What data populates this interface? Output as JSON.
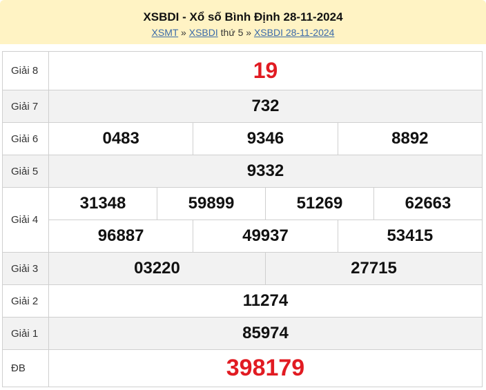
{
  "header": {
    "title": "XSBDI - Xổ số Bình Định 28-11-2024",
    "crumb_1": "XSMT",
    "sep_1": " » ",
    "crumb_2": "XSBDI",
    "crumb_2_suffix": " thứ 5",
    "sep_2": " » ",
    "crumb_3": "XSBDI 28-11-2024"
  },
  "prizes": {
    "g8": {
      "label": "Giải 8",
      "values": [
        "19"
      ]
    },
    "g7": {
      "label": "Giải 7",
      "values": [
        "732"
      ]
    },
    "g6": {
      "label": "Giải 6",
      "values": [
        "0483",
        "9346",
        "8892"
      ]
    },
    "g5": {
      "label": "Giải 5",
      "values": [
        "9332"
      ]
    },
    "g4": {
      "label": "Giải 4",
      "values": [
        "31348",
        "59899",
        "51269",
        "62663",
        "96887",
        "49937",
        "53415"
      ]
    },
    "g3": {
      "label": "Giải 3",
      "values": [
        "03220",
        "27715"
      ]
    },
    "g2": {
      "label": "Giải 2",
      "values": [
        "11274"
      ]
    },
    "g1": {
      "label": "Giải 1",
      "values": [
        "85974"
      ]
    },
    "db": {
      "label": "ĐB",
      "values": [
        "398179"
      ]
    }
  },
  "colors": {
    "header_bg": "#fff3c4",
    "highlight": "#e11b22",
    "link": "#3a6aa8",
    "row_alt": "#f2f2f2"
  }
}
